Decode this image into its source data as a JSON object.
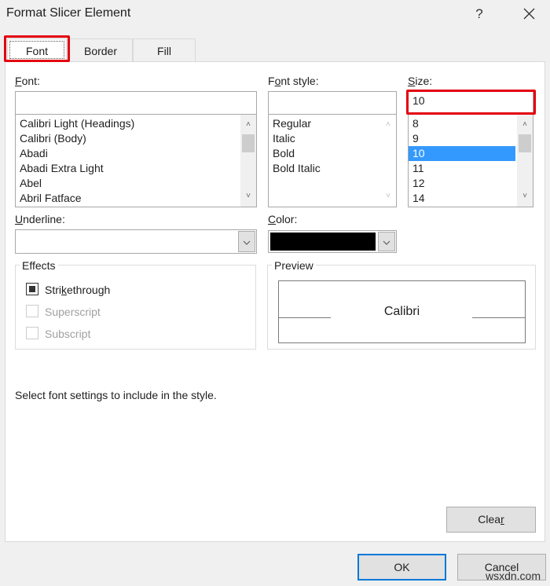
{
  "window": {
    "title": "Format Slicer Element",
    "help_label": "?",
    "close_icon": "close-icon"
  },
  "tabs": [
    {
      "label": "Font",
      "active": true
    },
    {
      "label": "Border",
      "active": false
    },
    {
      "label": "Fill",
      "active": false
    }
  ],
  "font": {
    "label_prefix": "F",
    "label_rest": "ont:",
    "value": "",
    "items": [
      "Calibri Light (Headings)",
      "Calibri (Body)",
      "Abadi",
      "Abadi Extra Light",
      "Abel",
      "Abril Fatface"
    ]
  },
  "font_style": {
    "label_a": "F",
    "label_u": "o",
    "label_b": "nt style:",
    "value": "",
    "items": [
      "Regular",
      "Italic",
      "Bold",
      "Bold Italic"
    ]
  },
  "size": {
    "label_u": "S",
    "label_rest": "ize:",
    "value": "10",
    "items": [
      "8",
      "9",
      "10",
      "11",
      "12",
      "14"
    ],
    "selected": "10"
  },
  "underline": {
    "label_u": "U",
    "label_rest": "nderline:",
    "value": ""
  },
  "color": {
    "label_u": "C",
    "label_rest": "olor:",
    "value_hex": "#000000"
  },
  "effects": {
    "legend": "Effects",
    "items": [
      {
        "label_a": "Stri",
        "label_u": "k",
        "label_b": "ethrough",
        "state": "indeterminate",
        "enabled": true
      },
      {
        "label_a": "Superscript",
        "label_u": "",
        "label_b": "",
        "state": "unchecked",
        "enabled": false
      },
      {
        "label_a": "Subscript",
        "label_u": "",
        "label_b": "",
        "state": "unchecked",
        "enabled": false
      }
    ]
  },
  "preview": {
    "legend": "Preview",
    "sample_text": "Calibri"
  },
  "hint": "Select font settings to include in the style.",
  "buttons": {
    "clear_a": "Clea",
    "clear_u": "r",
    "ok": "OK",
    "cancel": "Cancel"
  },
  "watermark": "wsxdn.com",
  "colors": {
    "highlight_red": "#e3000f",
    "selection_blue": "#3399ff",
    "default_button_border": "#0078d7"
  }
}
